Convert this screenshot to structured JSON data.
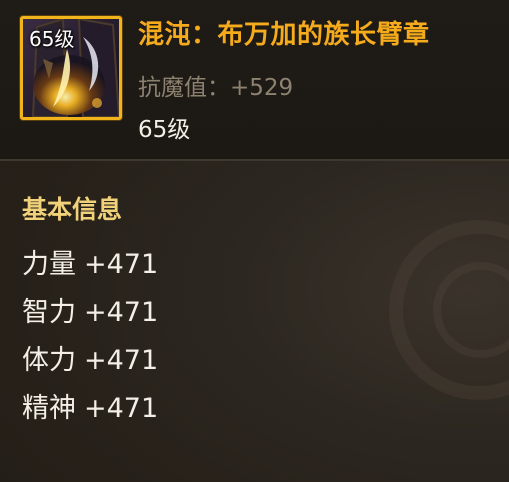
{
  "item": {
    "level_badge": "65级",
    "name": "混沌：布万加的族长臂章",
    "resistance_label": "抗魔值：",
    "resistance_value": "+529",
    "level_text": "65级",
    "icon": "armband-icon"
  },
  "basic_info": {
    "title": "基本信息",
    "attributes": [
      {
        "name": "力量",
        "value": "+471"
      },
      {
        "name": "智力",
        "value": "+471"
      },
      {
        "name": "体力",
        "value": "+471"
      },
      {
        "name": "精神",
        "value": "+471"
      }
    ]
  },
  "colors": {
    "title": "#f5ab1c",
    "frame": "#f1b41a",
    "section": "#f1d27a",
    "muted": "#8d8270",
    "text": "#f3efe6"
  }
}
